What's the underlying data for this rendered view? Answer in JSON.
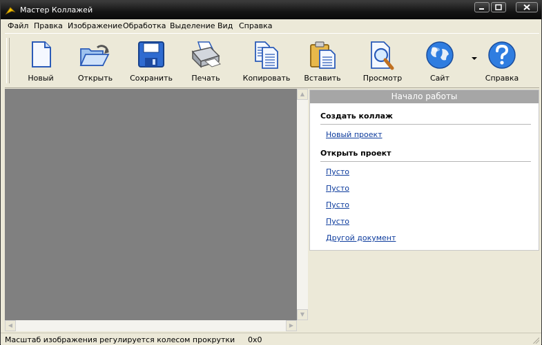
{
  "window": {
    "title": "Мастер Коллажей"
  },
  "menu": [
    "Файл",
    "Правка",
    "Изображение",
    "Обработка",
    "Выделение",
    "Вид",
    "Справка"
  ],
  "toolbar": {
    "new": "Новый",
    "open": "Открыть",
    "save": "Сохранить",
    "print": "Печать",
    "copy": "Копировать",
    "paste": "Вставить",
    "preview": "Просмотр",
    "site": "Сайт",
    "help": "Справка"
  },
  "panel": {
    "header": "Начало работы",
    "create_section": "Создать коллаж",
    "new_project": "Новый проект",
    "open_section": "Открыть проект",
    "recent": [
      "Пусто",
      "Пусто",
      "Пусто",
      "Пусто"
    ],
    "other_document": "Другой документ"
  },
  "status": {
    "hint": "Масштаб изображения регулируется колесом прокрутки",
    "size": "0x0"
  }
}
